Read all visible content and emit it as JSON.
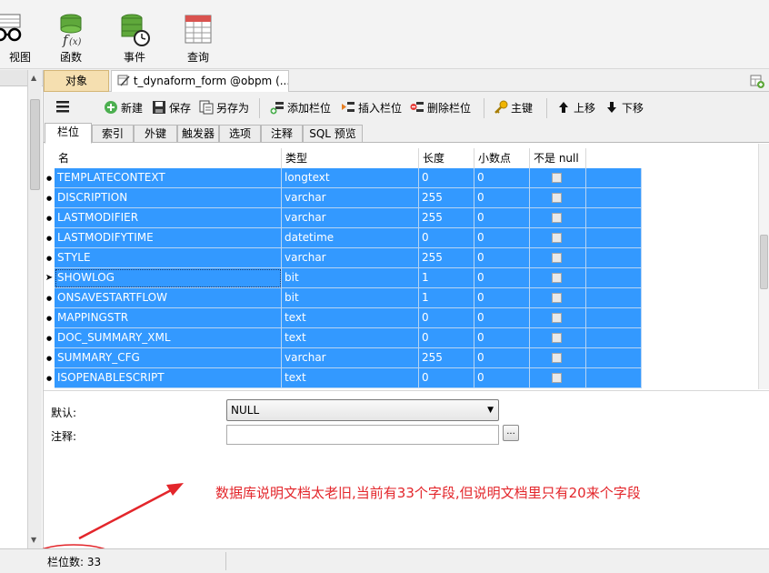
{
  "ribbon": {
    "items": [
      {
        "label": "视图",
        "icon": "view-glasses-icon"
      },
      {
        "label": "函数",
        "icon": "function-icon"
      },
      {
        "label": "事件",
        "icon": "event-icon"
      },
      {
        "label": "查询",
        "icon": "query-icon"
      }
    ]
  },
  "tabs": {
    "objects": "对象",
    "document": "t_dynaform_form @obpm (..."
  },
  "toolbar": {
    "menu_icon": "hamburger-menu-icon",
    "new": "新建",
    "save": "保存",
    "save_as": "另存为",
    "add_field": "添加栏位",
    "insert_field": "插入栏位",
    "delete_field": "删除栏位",
    "primary_key": "主键",
    "move_up": "上移",
    "move_down": "下移"
  },
  "subtabs": [
    "栏位",
    "索引",
    "外键",
    "触发器",
    "选项",
    "注释",
    "SQL 预览"
  ],
  "grid": {
    "headers": [
      "名",
      "类型",
      "长度",
      "小数点",
      "不是 null"
    ],
    "rows": [
      {
        "name": "TEMPLATECONTEXT",
        "type": "longtext",
        "length": "0",
        "decimals": "0",
        "not_null": false
      },
      {
        "name": "DISCRIPTION",
        "type": "varchar",
        "length": "255",
        "decimals": "0",
        "not_null": false
      },
      {
        "name": "LASTMODIFIER",
        "type": "varchar",
        "length": "255",
        "decimals": "0",
        "not_null": false
      },
      {
        "name": "LASTMODIFYTIME",
        "type": "datetime",
        "length": "0",
        "decimals": "0",
        "not_null": false
      },
      {
        "name": "STYLE",
        "type": "varchar",
        "length": "255",
        "decimals": "0",
        "not_null": false
      },
      {
        "name": "SHOWLOG",
        "type": "bit",
        "length": "1",
        "decimals": "0",
        "not_null": false,
        "current": true
      },
      {
        "name": "ONSAVESTARTFLOW",
        "type": "bit",
        "length": "1",
        "decimals": "0",
        "not_null": false
      },
      {
        "name": "MAPPINGSTR",
        "type": "text",
        "length": "0",
        "decimals": "0",
        "not_null": false
      },
      {
        "name": "DOC_SUMMARY_XML",
        "type": "text",
        "length": "0",
        "decimals": "0",
        "not_null": false
      },
      {
        "name": "SUMMARY_CFG",
        "type": "varchar",
        "length": "255",
        "decimals": "0",
        "not_null": false
      },
      {
        "name": "ISOPENABLESCRIPT",
        "type": "text",
        "length": "0",
        "decimals": "0",
        "not_null": false
      }
    ]
  },
  "props": {
    "default_label": "默认:",
    "default_value": "NULL",
    "comment_label": "注释:",
    "comment_value": "",
    "ellipsis": "..."
  },
  "annotation": "数据库说明文档太老旧,当前有33个字段,但说明文档里只有20来个字段",
  "status": {
    "field_count": "栏位数: 33"
  },
  "colors": {
    "selection": "#3399ff",
    "annotation": "#e3262b",
    "objects_tab": "#f5dfb0"
  }
}
